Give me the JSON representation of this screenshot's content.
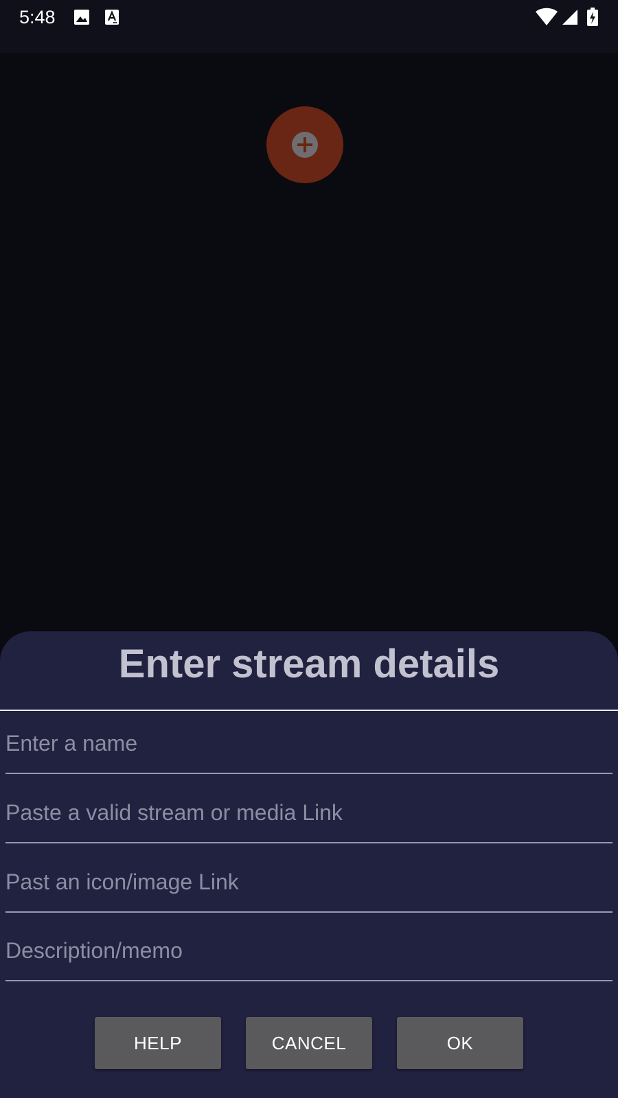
{
  "status_bar": {
    "time": "5:48",
    "icons": [
      "image-icon",
      "text-recognition-icon",
      "wifi-icon",
      "cell-signal-icon",
      "battery-charging-icon"
    ]
  },
  "app": {
    "fab_icon": "add-circle-icon",
    "accent_color": "#6a2614"
  },
  "dialog": {
    "title": "Enter stream details",
    "fields": [
      {
        "placeholder": "Enter a name",
        "value": ""
      },
      {
        "placeholder": "Paste a valid stream or media Link",
        "value": ""
      },
      {
        "placeholder": "Past an icon/image Link",
        "value": ""
      },
      {
        "placeholder": "Description/memo",
        "value": ""
      }
    ],
    "buttons": {
      "help": "HELP",
      "cancel": "CANCEL",
      "ok": "OK"
    },
    "background_color": "#212140"
  }
}
